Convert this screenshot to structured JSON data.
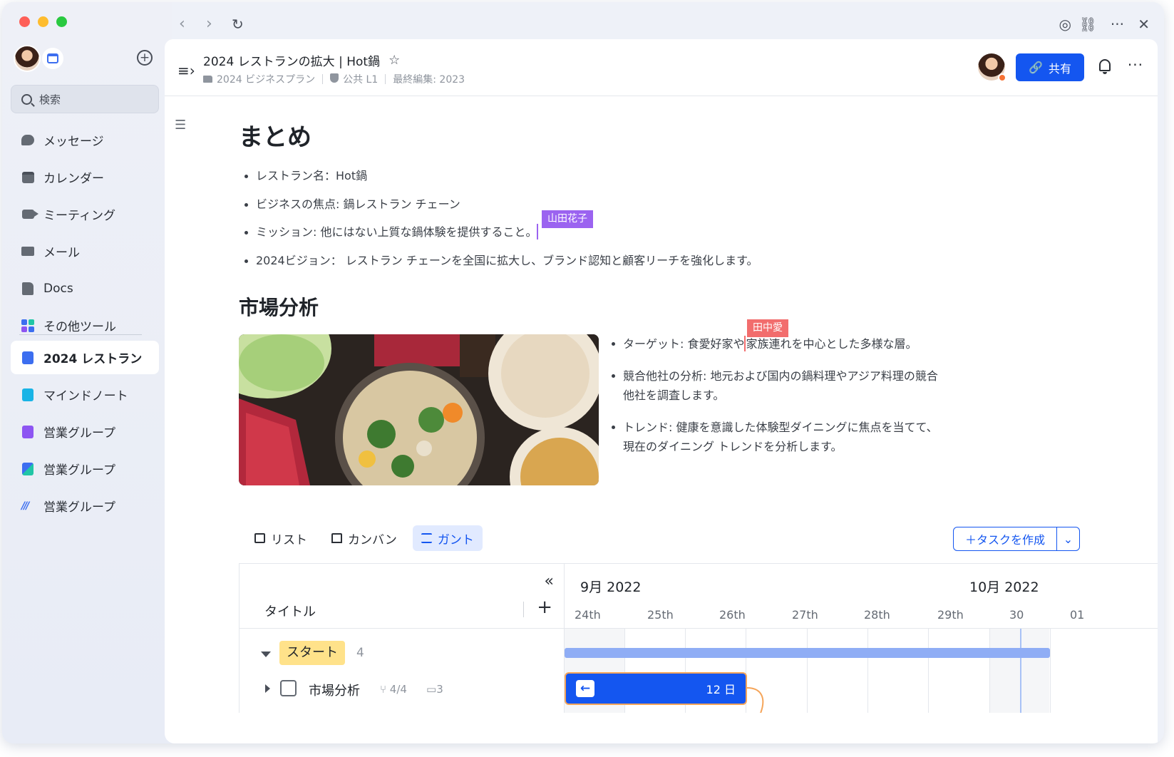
{
  "sidebar": {
    "search_placeholder": "検索",
    "items": [
      {
        "label": "メッセージ",
        "icon": "message-icon"
      },
      {
        "label": "カレンダー",
        "icon": "calendar-icon"
      },
      {
        "label": "ミーティング",
        "icon": "video-icon"
      },
      {
        "label": "メール",
        "icon": "mail-icon"
      },
      {
        "label": "Docs",
        "icon": "docs-icon"
      },
      {
        "label": "その他ツール",
        "icon": "tools-icon"
      }
    ],
    "pinned": [
      {
        "label": "2024 レストラン",
        "icon": "doc-icon",
        "active": true
      },
      {
        "label": "マインドノート",
        "icon": "mindnote-icon"
      },
      {
        "label": "営業グループ",
        "icon": "sheet-icon"
      },
      {
        "label": "営業グループ",
        "icon": "base-icon"
      },
      {
        "label": "営業グループ",
        "icon": "wiki-icon"
      }
    ]
  },
  "header": {
    "title": "2024 レストランの拡大 | Hot鍋",
    "folder": "2024 ビジネスプラン",
    "visibility": "公共 L1",
    "last_edited": "最終編集: 2023",
    "share_label": "共有"
  },
  "doc": {
    "h1": "まとめ",
    "summary_bullets": [
      "レストラン名：Hot鍋",
      "ビジネスの焦点: 鍋レストラン チェーン",
      "ミッション: 他にはない上質な鍋体験を提供すること。",
      "2024ビジョン： レストラン チェーンを全国に拡大し、ブランド認知と顧客リーチを強化します。"
    ],
    "cursor1_name": "山田花子",
    "h2": "市場分析",
    "market_bullets": {
      "target_before": "ターゲット: 食愛好家や",
      "target_after": "家族連れを中心とした多様な層。",
      "competitors": "競合他社の分析: 地元および国内の鍋料理やアジア料理の競合他社を調査します。",
      "trends": "トレンド: 健康を意識した体験型ダイニングに焦点を当てて、現在のダイニング トレンドを分析します。"
    },
    "cursor2_name": "田中愛"
  },
  "views": {
    "tabs": [
      "リスト",
      "カンバン",
      "ガント"
    ],
    "active_tab": "ガント",
    "create_task": "タスクを作成"
  },
  "gantt": {
    "title_col": "タイトル",
    "months": [
      "9月 2022",
      "10月 2022"
    ],
    "days": [
      "24th",
      "25th",
      "26th",
      "27th",
      "28th",
      "29th",
      "30",
      "01"
    ],
    "group_name": "スタート",
    "group_count": "4",
    "task_name": "市場分析",
    "task_subtasks": "4/4",
    "task_comments": "3",
    "task_duration": "12 日"
  },
  "colors": {
    "accent": "#1456f0",
    "group_tag": "#ffe28a",
    "cursor1": "#9b63f0",
    "cursor2": "#f26d6d"
  }
}
